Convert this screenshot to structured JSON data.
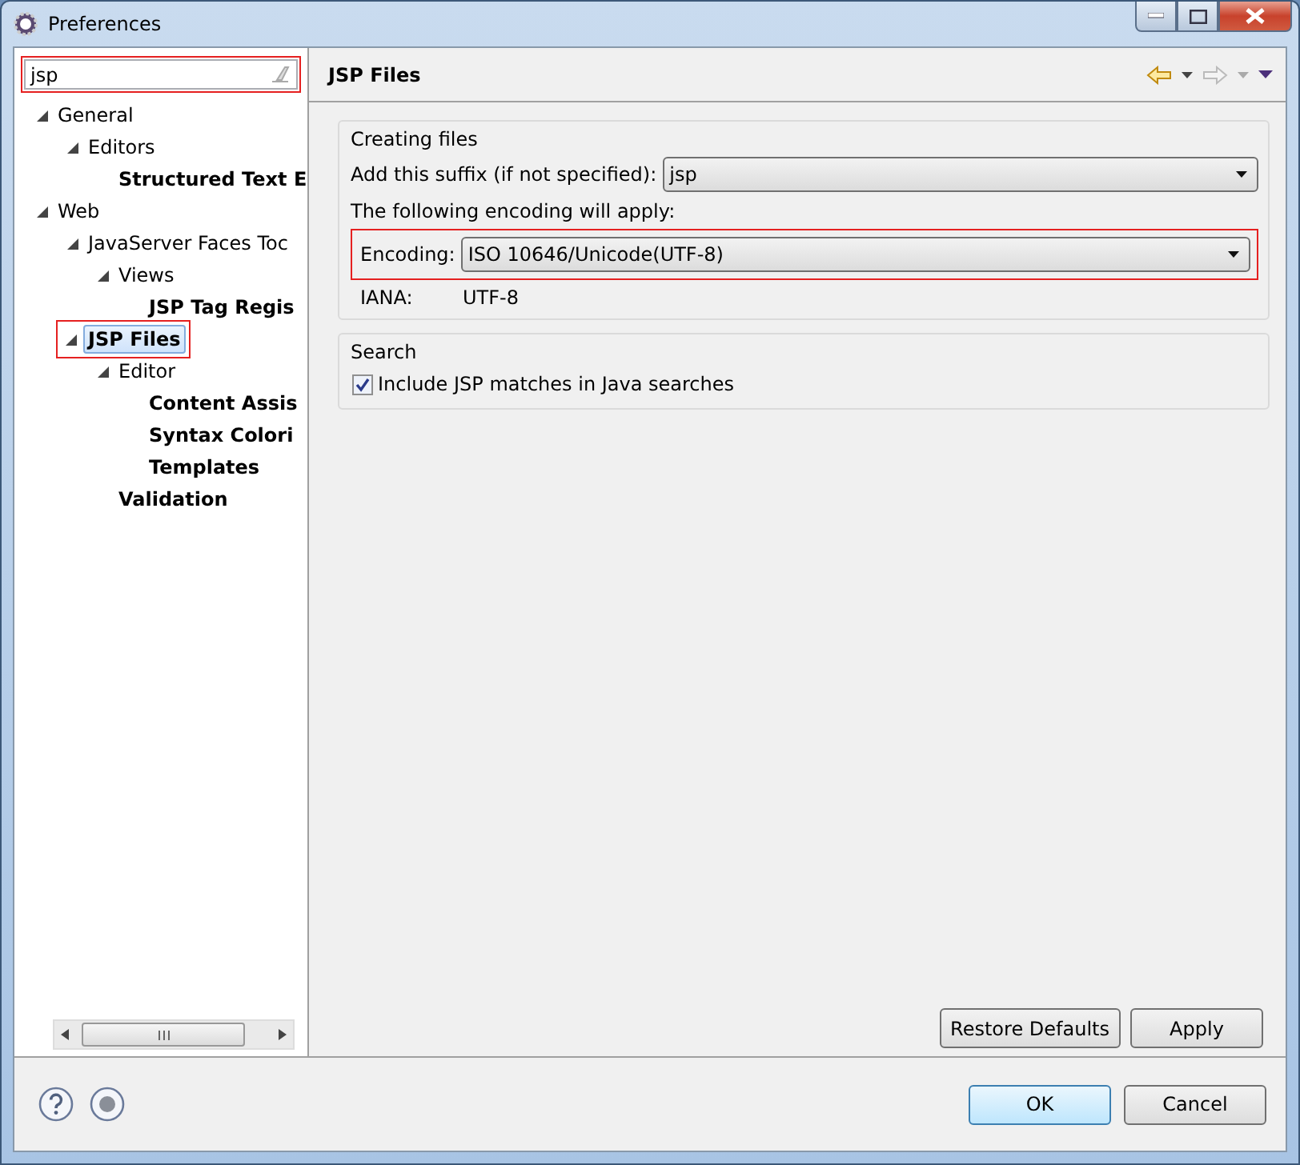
{
  "window": {
    "title": "Preferences"
  },
  "filter": {
    "value": "jsp"
  },
  "tree": [
    {
      "label": "General",
      "matched": false,
      "selected": false,
      "expanded": true,
      "children": [
        {
          "label": "Editors",
          "matched": false,
          "selected": false,
          "expanded": true,
          "children": [
            {
              "label": "Structured Text E",
              "matched": true,
              "selected": false
            }
          ]
        }
      ]
    },
    {
      "label": "Web",
      "matched": false,
      "selected": false,
      "expanded": true,
      "children": [
        {
          "label": "JavaServer Faces Toc",
          "matched": false,
          "selected": false,
          "expanded": true,
          "children": [
            {
              "label": "Views",
              "matched": false,
              "selected": false,
              "expanded": true,
              "children": [
                {
                  "label": "JSP Tag Regis",
                  "matched": true,
                  "selected": false
                }
              ]
            }
          ]
        },
        {
          "label": "JSP Files",
          "matched": true,
          "selected": true,
          "expanded": true,
          "children": [
            {
              "label": "Editor",
              "matched": false,
              "selected": false,
              "expanded": true,
              "children": [
                {
                  "label": "Content Assis",
                  "matched": true,
                  "selected": false
                },
                {
                  "label": "Syntax Colori",
                  "matched": true,
                  "selected": false
                },
                {
                  "label": "Templates",
                  "matched": true,
                  "selected": false
                }
              ]
            },
            {
              "label": "Validation",
              "matched": true,
              "selected": false
            }
          ]
        }
      ]
    }
  ],
  "page": {
    "title": "JSP Files",
    "creating": {
      "title": "Creating files",
      "suffix_label": "Add this suffix (if not specified):",
      "suffix_value": "jsp",
      "note": "The following encoding will apply:",
      "encoding_label": "Encoding:",
      "encoding_value": "ISO 10646/Unicode(UTF-8)",
      "iana_label": "IANA:",
      "iana_value": "UTF-8"
    },
    "search": {
      "title": "Search",
      "option": {
        "label": "Include JSP matches in Java searches",
        "checked": true
      }
    },
    "buttons": [
      "Restore Defaults",
      "Apply"
    ]
  },
  "footer": {
    "buttons": [
      {
        "label": "OK",
        "default": true
      },
      {
        "label": "Cancel",
        "default": false
      }
    ]
  }
}
